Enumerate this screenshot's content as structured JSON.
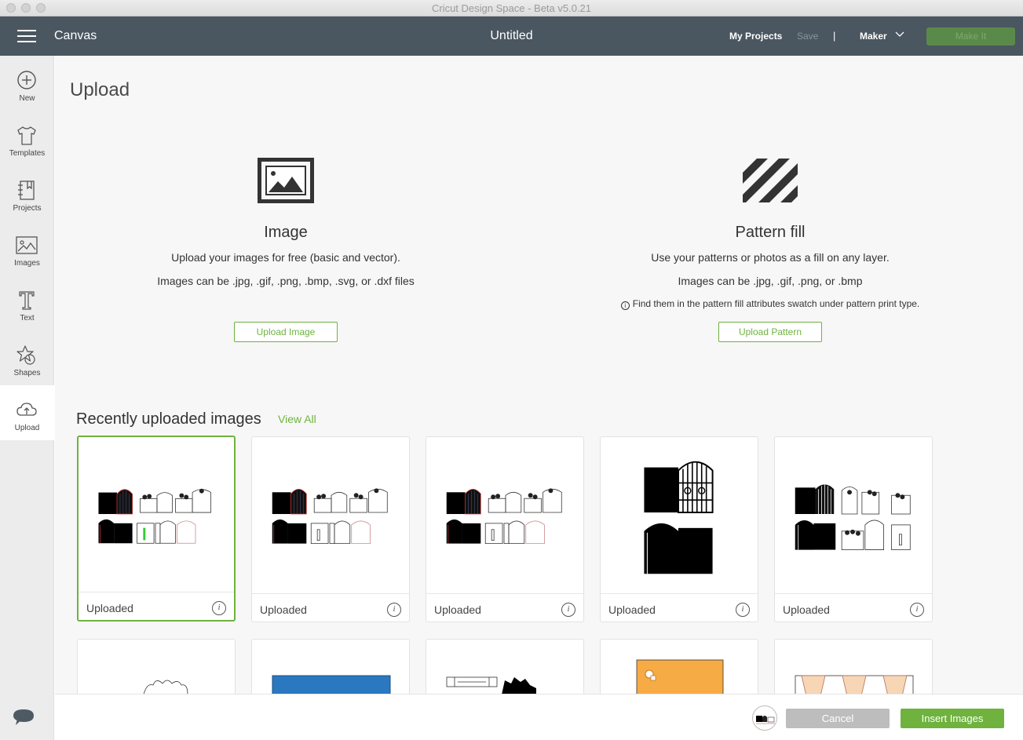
{
  "window": {
    "title": "Cricut Design Space - Beta v5.0.21"
  },
  "topnav": {
    "canvas_label": "Canvas",
    "project_title": "Untitled",
    "my_projects": "My Projects",
    "save": "Save",
    "separator": "|",
    "machine": "Maker",
    "make_it": "Make It"
  },
  "sidebar": {
    "items": [
      {
        "label": "New",
        "icon": "plus-circle-icon"
      },
      {
        "label": "Templates",
        "icon": "tshirt-icon"
      },
      {
        "label": "Projects",
        "icon": "notebook-icon"
      },
      {
        "label": "Images",
        "icon": "image-icon"
      },
      {
        "label": "Text",
        "icon": "text-icon"
      },
      {
        "label": "Shapes",
        "icon": "shapes-icon"
      },
      {
        "label": "Upload",
        "icon": "cloud-upload-icon",
        "active": true
      }
    ]
  },
  "main": {
    "page_title": "Upload",
    "image_section": {
      "heading": "Image",
      "desc1": "Upload your images for free (basic and vector).",
      "desc2": "Images can be .jpg, .gif, .png, .bmp, .svg, or .dxf files",
      "button": "Upload Image"
    },
    "pattern_section": {
      "heading": "Pattern fill",
      "desc1": "Use your patterns or photos as a fill on any layer.",
      "desc2": "Images can be .jpg, .gif, .png, or .bmp",
      "note_icon": "i",
      "note": "Find them in the pattern fill attributes swatch under pattern print type.",
      "button": "Upload Pattern"
    },
    "recent": {
      "title": "Recently uploaded images",
      "view_all": "View All",
      "cards": [
        {
          "label": "Uploaded",
          "info": "i"
        },
        {
          "label": "Uploaded",
          "info": "i"
        },
        {
          "label": "Uploaded",
          "info": "i"
        },
        {
          "label": "Uploaded",
          "info": "i"
        },
        {
          "label": "Uploaded",
          "info": "i"
        }
      ]
    }
  },
  "bottombar": {
    "cancel": "Cancel",
    "insert": "Insert Images"
  },
  "colors": {
    "accent_green": "#6fb23e",
    "nav_bg": "#4a5660",
    "make_it_bg": "#5a8a4a",
    "cancel_bg": "#bdbdbd",
    "pattern_orange": "#f6ab45",
    "pattern_blue": "#2a78c0"
  }
}
